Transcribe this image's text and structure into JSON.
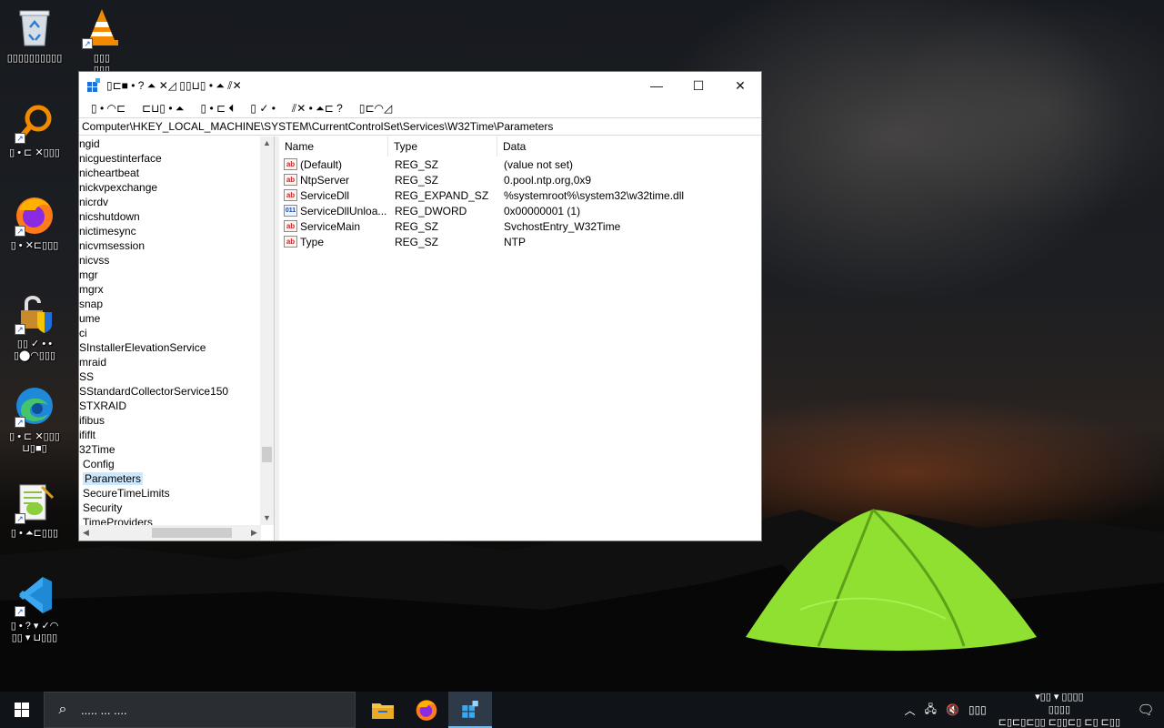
{
  "desktop": {
    "icons": [
      {
        "name": "recycle-bin",
        "label": "▯▯▯▯▯▯▯▯▯▯"
      },
      {
        "name": "vlc",
        "label": "▯▯▯\n▯▯▯"
      },
      {
        "name": "search-tool",
        "label": "▯ • ⊏ ✕▯▯▯"
      },
      {
        "name": "firefox",
        "label": "▯ • ✕⊏▯▯▯"
      },
      {
        "name": "unlock-tool",
        "label": "▯▯ ✓ • •\n▯⬤◠▯▯▯"
      },
      {
        "name": "edge",
        "label": "▯ • ⊏ ✕▯▯▯\n⊔▯■▯"
      },
      {
        "name": "notepad-plus",
        "label": "▯ • ⏶⊏▯▯▯"
      },
      {
        "name": "vscode",
        "label": "▯ • ? ▾ ✓◠\n▯▯ ▾ ⊔▯▯▯"
      }
    ]
  },
  "window": {
    "title": "▯⊏■ • ? ⏶ ✕◿ ▯▯⊔▯ • ⏶ ⫽✕",
    "controls": {
      "minimize": "—",
      "maximize": "☐",
      "close": "✕"
    },
    "menu": [
      "▯ • ◠⊏",
      "⊏⊔▯ • ⏶",
      "▯ • ⊏ ⏴",
      "▯ ✓ •",
      "⫽✕ • ⏶⊏ ?",
      "▯⊏◠◿"
    ],
    "address": "Computer\\HKEY_LOCAL_MACHINE\\SYSTEM\\CurrentControlSet\\Services\\W32Time\\Parameters",
    "tree": [
      "ngid",
      "nicguestinterface",
      "nicheartbeat",
      "nickvpexchange",
      "nicrdv",
      "nicshutdown",
      "nictimesync",
      "nicvmsession",
      "nicvss",
      "mgr",
      "mgrx",
      "snap",
      "ume",
      "ci",
      "SInstallerElevationService",
      "mraid",
      "SS",
      "SStandardCollectorService150",
      "STXRAID",
      "ifibus",
      "ififlt",
      "32Time",
      "Config",
      "Parameters",
      "SecureTimeLimits",
      "Security",
      "TimeProviders"
    ],
    "selected_tree_item": "Parameters",
    "columns": {
      "name": "Name",
      "type": "Type",
      "data": "Data"
    },
    "values": [
      {
        "icon": "ab",
        "name": "(Default)",
        "type": "REG_SZ",
        "data": "(value not set)"
      },
      {
        "icon": "ab",
        "name": "NtpServer",
        "type": "REG_SZ",
        "data": "0.pool.ntp.org,0x9"
      },
      {
        "icon": "ab",
        "name": "ServiceDll",
        "type": "REG_EXPAND_SZ",
        "data": "%systemroot%\\system32\\w32time.dll"
      },
      {
        "icon": "011",
        "name": "ServiceDllUnloa...",
        "type": "REG_DWORD",
        "data": "0x00000001 (1)"
      },
      {
        "icon": "ab",
        "name": "ServiceMain",
        "type": "REG_SZ",
        "data": "SvchostEntry_W32Time"
      },
      {
        "icon": "ab",
        "name": "Type",
        "type": "REG_SZ",
        "data": "NTP"
      }
    ]
  },
  "taskbar": {
    "search_placeholder": "..... ... ....",
    "tray_lang": "▯▯▯",
    "clock_time": "▾▯▯ ▾ ▯▯▯▯",
    "clock_mid": "▯▯▯▯",
    "clock_date": "⊏▯⊏▯⊏▯▯ ⊏▯▯⊏▯ ⊏▯ ⊏▯▯"
  },
  "colors": {
    "taskbar": "#101317",
    "selection": "#cce8ff",
    "accent": "#76b9ed"
  }
}
